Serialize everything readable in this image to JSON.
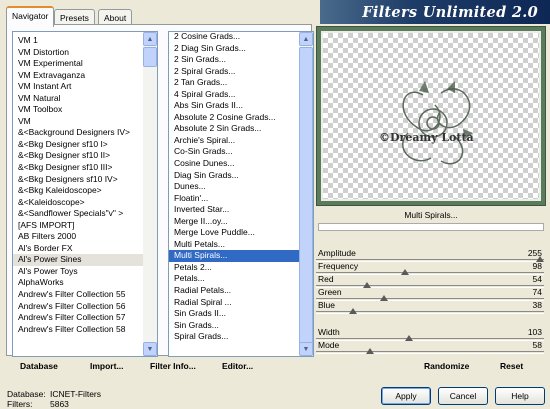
{
  "tabs": [
    "Navigator",
    "Presets",
    "About"
  ],
  "categories": [
    "VM 1",
    "VM Distortion",
    "VM Experimental",
    "VM Extravaganza",
    "VM Instant Art",
    "VM Natural",
    "VM Toolbox",
    "VM",
    "&<Background Designers IV>",
    "&<Bkg Designer sf10 I>",
    "&<Bkg Designer sf10 II>",
    "&<Bkg Designer sf10 III>",
    "&<Bkg Designers sf10 IV>",
    "&<Bkg Kaleidoscope>",
    "&<Kaleidoscope>",
    "&<Sandflower Specials\"v\" >",
    "[AFS IMPORT]",
    "AB Filters 2000",
    "Al's Border FX",
    "Al's Power Sines",
    "Al's Power Toys",
    "AlphaWorks",
    "Andrew's Filter Collection 55",
    "Andrew's Filter Collection 56",
    "Andrew's Filter Collection 57",
    "Andrew's Filter Collection 58"
  ],
  "filters": [
    "2 Cosine Grads...",
    "2 Diag Sin Grads...",
    "2 Sin Grads...",
    "2 Spiral Grads...",
    "2 Tan Grads...",
    "4 Spiral Grads...",
    "Abs Sin Grads II...",
    "Absolute 2 Cosine Grads...",
    "Absolute 2 Sin Grads...",
    "Archie's Spiral...",
    "Co-Sin Grads...",
    "Cosine Dunes...",
    "Diag Sin Grads...",
    "Dunes...",
    "Floatin'...",
    "Inverted Star...",
    "Merge II...oy...",
    "Merge Love Puddle...",
    "Multi Petals...",
    "Multi Spirals...",
    "Petals 2...",
    "Petals...",
    "Radial Petals...",
    "Radial Spiral ...",
    "Sin Grads II...",
    "Sin Grads...",
    "Spiral Grads..."
  ],
  "bottom_buttons": {
    "database": "Database",
    "import": "Import...",
    "filter_info": "Filter Info...",
    "editor": "Editor..."
  },
  "status": {
    "database_label": "Database:",
    "database_value": "ICNET-Filters",
    "filters_label": "Filters:",
    "filters_value": "5863"
  },
  "banner_title": "Filters Unlimited 2.0",
  "preview_watermark": "©Dreamy Lotta",
  "selected_filter": "Multi Spirals...",
  "params": [
    {
      "label": "Amplitude",
      "value": 255
    },
    {
      "label": "Frequency",
      "value": 98
    },
    {
      "label": "Red",
      "value": 54
    },
    {
      "label": "Green",
      "value": 74
    },
    {
      "label": "Blue",
      "value": 38
    },
    {
      "label": "Width",
      "value": 103
    },
    {
      "label": "Mode",
      "value": 58
    }
  ],
  "actions": {
    "randomize": "Randomize",
    "reset": "Reset"
  },
  "dialog": {
    "apply": "Apply",
    "cancel": "Cancel",
    "help": "Help"
  },
  "colors": {
    "selection": "#316ac5",
    "banner": "#1e3c68",
    "tab_accent": "#e68b2c"
  },
  "icons": {
    "scroll_up": "scroll-up-arrow-icon",
    "scroll_down": "scroll-down-arrow-icon"
  }
}
